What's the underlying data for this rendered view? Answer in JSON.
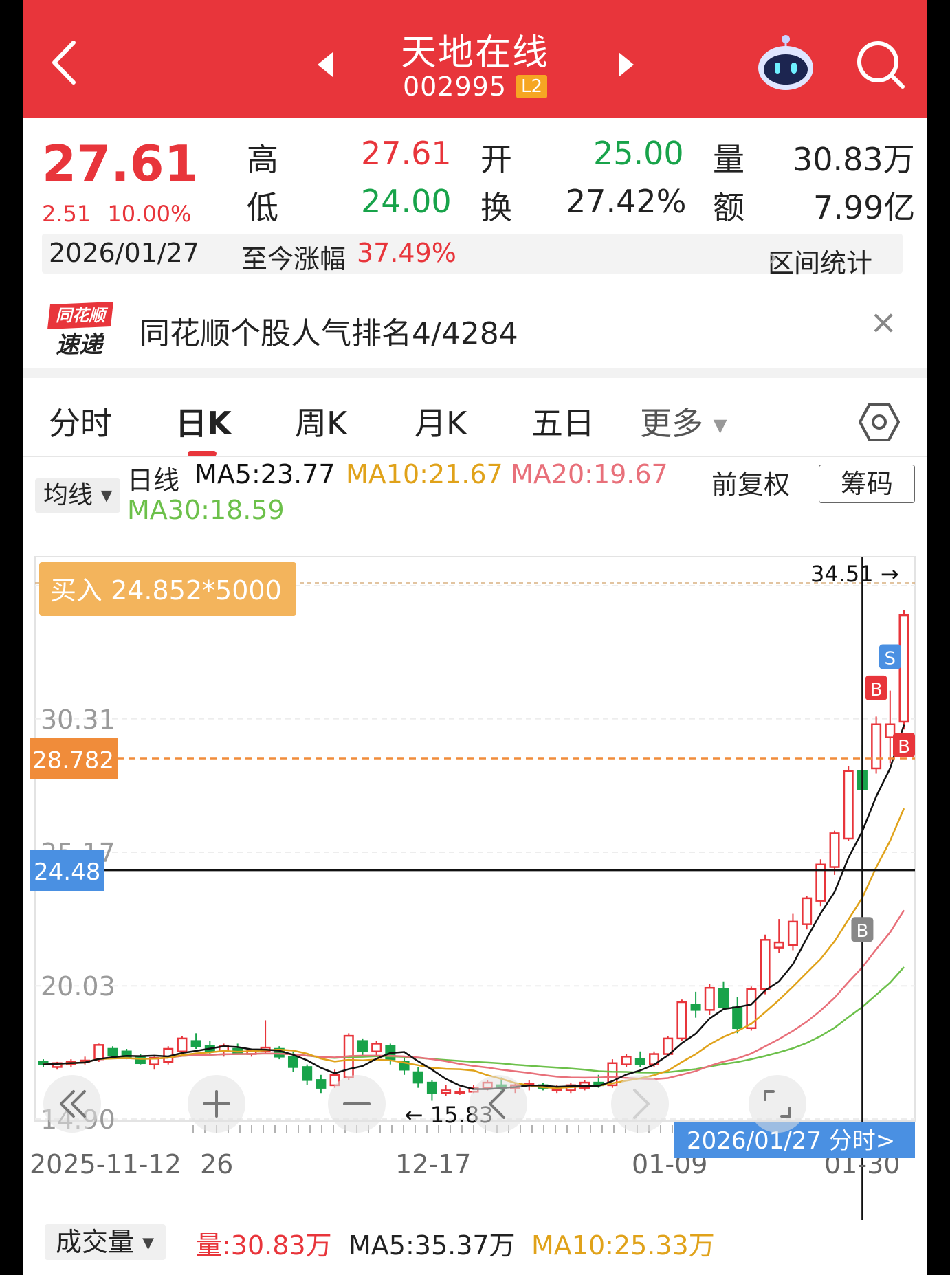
{
  "header": {
    "title": "天地在线",
    "code": "002995",
    "level_badge": "L2"
  },
  "quote": {
    "price": "27.61",
    "change": "2.51",
    "change_pct": "10.00%",
    "high_label": "高",
    "high": "27.61",
    "low_label": "低",
    "low": "24.00",
    "open_label": "开",
    "open": "25.00",
    "turnover_label": "换",
    "turnover": "27.42%",
    "volume_label": "量",
    "volume": "30.83万",
    "amount_label": "额",
    "amount": "7.99亿",
    "date": "2026/01/27",
    "since_label": "至今涨幅",
    "since_value": "37.49%",
    "range_stats": "区间统计"
  },
  "promo": {
    "logo_top": "同花顺",
    "logo_bottom": "速递",
    "text": "同花顺个股人气排名4/4284",
    "close": "×"
  },
  "tabs": [
    {
      "label": "分时"
    },
    {
      "label": "日K"
    },
    {
      "label": "周K"
    },
    {
      "label": "月K"
    },
    {
      "label": "五日"
    },
    {
      "label": "更多"
    }
  ],
  "indicator": {
    "select": "均线",
    "line_label": "日线",
    "ma5": "MA5:23.77",
    "ma10": "MA10:21.67",
    "ma20": "MA20:19.67",
    "ma30": "MA30:18.59",
    "adjust": "前复权",
    "chips": "筹码"
  },
  "colors": {
    "red": "#e8353b",
    "green": "#18a34a",
    "ma5": "#111111",
    "ma10": "#e0a21a",
    "ma20": "#e8707a",
    "ma30": "#6cc04a",
    "orange": "#f08c3a",
    "blue": "#4a90e2"
  },
  "chart_data": {
    "type": "candlestick",
    "y_ticks": [
      "35.44",
      "30.31",
      "25.17",
      "20.03",
      "14.90"
    ],
    "ylim": [
      14.9,
      35.44
    ],
    "x_ticks": [
      "2025-11-12",
      "26",
      "12-17",
      "01-09",
      "01-30"
    ],
    "order_label": "买入 24.852*5000",
    "cost_line": "28.782",
    "crosshair_price": "24.48",
    "max_label": "34.51 →",
    "min_label": "← 15.83",
    "date_button": "2026/01/27 分时>",
    "trade_marks": [
      "B",
      "S",
      "B",
      "B"
    ],
    "candles": [
      [
        17.1,
        17.2,
        16.9,
        17.0
      ],
      [
        16.9,
        17.1,
        16.8,
        17.05
      ],
      [
        17.0,
        17.2,
        16.9,
        17.1
      ],
      [
        17.1,
        17.3,
        17.0,
        17.15
      ],
      [
        17.2,
        17.8,
        17.1,
        17.75
      ],
      [
        17.6,
        17.7,
        17.3,
        17.35
      ],
      [
        17.5,
        17.6,
        17.2,
        17.3
      ],
      [
        17.3,
        17.4,
        17.0,
        17.05
      ],
      [
        17.0,
        17.3,
        16.8,
        17.25
      ],
      [
        17.1,
        17.7,
        17.0,
        17.6
      ],
      [
        17.5,
        18.1,
        17.4,
        18.0
      ],
      [
        17.9,
        18.2,
        17.6,
        17.7
      ],
      [
        17.7,
        17.9,
        17.4,
        17.5
      ],
      [
        17.5,
        17.8,
        17.3,
        17.7
      ],
      [
        17.6,
        17.8,
        17.4,
        17.45
      ],
      [
        17.4,
        17.6,
        17.3,
        17.55
      ],
      [
        17.5,
        18.7,
        17.4,
        17.65
      ],
      [
        17.6,
        17.7,
        17.2,
        17.3
      ],
      [
        17.3,
        17.5,
        16.7,
        16.9
      ],
      [
        16.9,
        17.0,
        16.2,
        16.4
      ],
      [
        16.4,
        16.6,
        15.9,
        16.1
      ],
      [
        16.2,
        16.8,
        16.1,
        16.6
      ],
      [
        16.5,
        18.2,
        16.4,
        18.1
      ],
      [
        17.9,
        18.0,
        17.3,
        17.5
      ],
      [
        17.5,
        17.9,
        17.3,
        17.8
      ],
      [
        17.7,
        17.8,
        17.0,
        17.2
      ],
      [
        17.1,
        17.3,
        16.6,
        16.8
      ],
      [
        16.7,
        16.9,
        16.1,
        16.3
      ],
      [
        16.3,
        16.4,
        15.6,
        15.9
      ],
      [
        15.9,
        16.2,
        15.8,
        16.0
      ],
      [
        15.9,
        16.1,
        15.83,
        15.95
      ],
      [
        15.95,
        16.2,
        15.9,
        16.1
      ],
      [
        16.1,
        16.4,
        16.0,
        16.3
      ],
      [
        16.2,
        16.5,
        16.0,
        16.1
      ],
      [
        16.1,
        16.3,
        15.9,
        16.2
      ],
      [
        16.2,
        16.4,
        16.0,
        16.25
      ],
      [
        16.2,
        16.3,
        16.0,
        16.1
      ],
      [
        16.0,
        16.2,
        15.9,
        16.05
      ],
      [
        16.0,
        16.3,
        15.9,
        16.2
      ],
      [
        16.1,
        16.4,
        16.0,
        16.3
      ],
      [
        16.3,
        16.6,
        16.1,
        16.2
      ],
      [
        16.2,
        17.2,
        16.1,
        17.05
      ],
      [
        17.0,
        17.4,
        16.9,
        17.3
      ],
      [
        17.2,
        17.5,
        16.9,
        17.0
      ],
      [
        17.0,
        17.5,
        16.9,
        17.4
      ],
      [
        17.4,
        18.1,
        17.3,
        18.0
      ],
      [
        18.0,
        19.5,
        17.9,
        19.4
      ],
      [
        19.3,
        19.8,
        18.8,
        19.1
      ],
      [
        19.1,
        20.1,
        18.9,
        19.95
      ],
      [
        19.9,
        20.2,
        19.1,
        19.2
      ],
      [
        19.2,
        19.6,
        18.2,
        18.4
      ],
      [
        18.4,
        20.0,
        18.3,
        19.9
      ],
      [
        19.9,
        22.0,
        19.7,
        21.8
      ],
      [
        21.5,
        22.6,
        21.3,
        21.7
      ],
      [
        21.6,
        22.8,
        21.4,
        22.5
      ],
      [
        22.4,
        23.5,
        22.2,
        23.4
      ],
      [
        23.3,
        24.9,
        23.1,
        24.7
      ],
      [
        24.6,
        26.0,
        24.3,
        25.9
      ],
      [
        25.7,
        28.5,
        25.6,
        28.3
      ],
      [
        28.3,
        29.3,
        27.1,
        27.6
      ],
      [
        28.4,
        30.4,
        28.2,
        30.1
      ],
      [
        29.6,
        31.4,
        28.6,
        30.1
      ],
      [
        30.2,
        34.51,
        29.9,
        34.3
      ]
    ]
  },
  "volume": {
    "select": "成交量",
    "vol": "量:30.83万",
    "ma5": "MA5:35.37万",
    "ma10": "MA10:25.33万"
  }
}
